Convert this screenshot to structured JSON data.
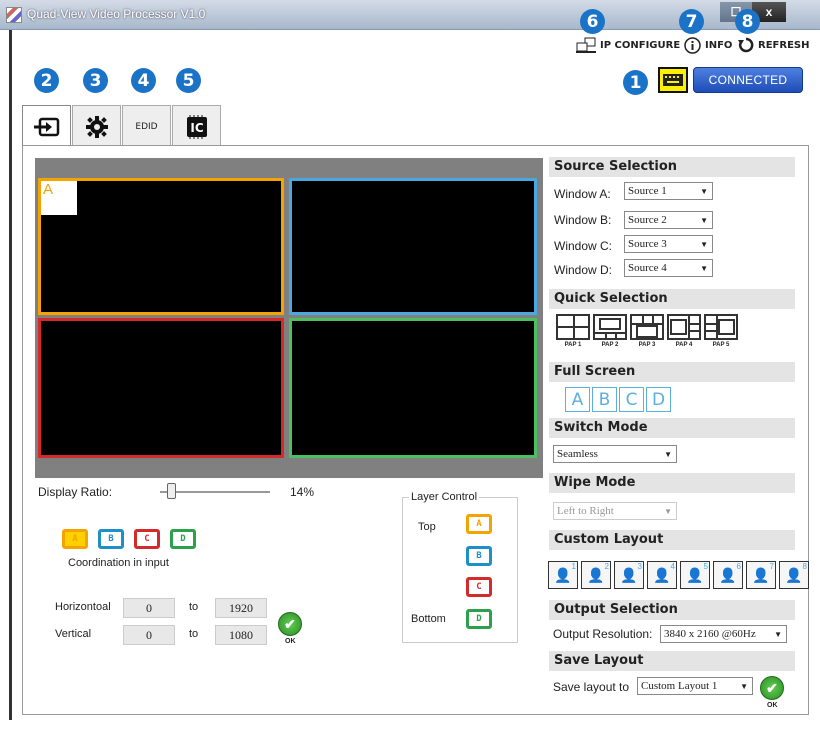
{
  "window": {
    "title": "Quad-View Video Processor V1.0",
    "close": "x"
  },
  "badges": {
    "b1": "1",
    "b2": "2",
    "b3": "3",
    "b4": "4",
    "b5": "5",
    "b6": "6",
    "b7": "7",
    "b8": "8"
  },
  "topnav": {
    "ip_configure": "IP CONFIGURE",
    "info": "INFO",
    "refresh": "REFRESH"
  },
  "status": {
    "connected": "CONNECTED"
  },
  "tabs": {
    "edid": "EDID"
  },
  "preview": {
    "window_a_label": "A"
  },
  "display_ratio": {
    "label": "Display Ratio:",
    "value": "14%",
    "level": 0.14
  },
  "coordination": {
    "monitors": [
      "A",
      "B",
      "C",
      "D"
    ],
    "label": "Coordination in input",
    "horizontal_label": "Horizontoal",
    "vertical_label": "Vertical",
    "to": "to",
    "h_from": "0",
    "h_to": "1920",
    "v_from": "0",
    "v_to": "1080",
    "ok": "OK"
  },
  "layer_control": {
    "title": "Layer Control",
    "top": "Top",
    "bottom": "Bottom",
    "order": [
      "A",
      "B",
      "C",
      "D"
    ]
  },
  "source_selection": {
    "title": "Source Selection",
    "rows": [
      {
        "label": "Window A:",
        "value": "Source 1"
      },
      {
        "label": "Window B:",
        "value": "Source 2"
      },
      {
        "label": "Window C:",
        "value": "Source 3"
      },
      {
        "label": "Window D:",
        "value": "Source 4"
      }
    ]
  },
  "quick_selection": {
    "title": "Quick Selection",
    "items": [
      "PAP 1",
      "PAP 2",
      "PAP 3",
      "PAP 4",
      "PAP 5"
    ]
  },
  "full_screen": {
    "title": "Full Screen",
    "buttons": [
      "A",
      "B",
      "C",
      "D"
    ]
  },
  "switch_mode": {
    "title": "Switch Mode",
    "value": "Seamless"
  },
  "wipe_mode": {
    "title": "Wipe Mode",
    "value": "Left to Right"
  },
  "custom_layout": {
    "title": "Custom Layout",
    "slots": [
      "1",
      "2",
      "3",
      "4",
      "5",
      "6",
      "7",
      "8"
    ]
  },
  "output_selection": {
    "title": "Output Selection",
    "label": "Output Resolution:",
    "value": "3840 x 2160 @60Hz"
  },
  "save_layout": {
    "title": "Save Layout",
    "label": "Save layout to",
    "value": "Custom Layout 1",
    "ok": "OK"
  },
  "colors": {
    "a": "#f4a300",
    "b": "#1f8fc9",
    "c": "#d42a2a",
    "d": "#2aa14a",
    "accent": "#1b73c7"
  }
}
